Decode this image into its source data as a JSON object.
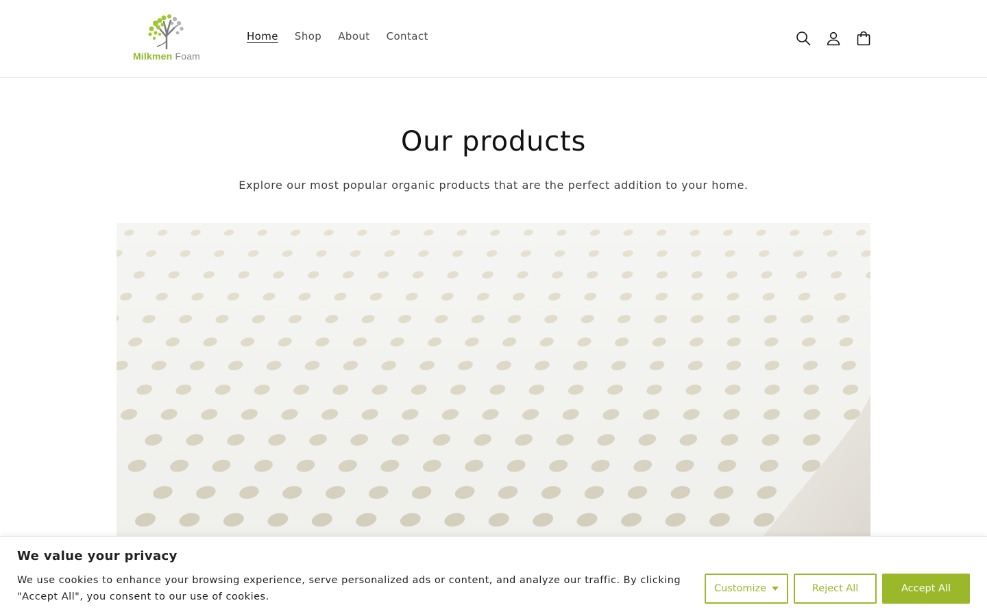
{
  "header": {
    "logo": {
      "word1": "Milkmen",
      "word2": "Foam",
      "brand_green": "#8dbb2b",
      "brand_gray": "#8a8a8a"
    },
    "nav": [
      {
        "label": "Home",
        "active": true
      },
      {
        "label": "Shop",
        "active": false
      },
      {
        "label": "About",
        "active": false
      },
      {
        "label": "Contact",
        "active": false
      }
    ],
    "icons": [
      "search-icon",
      "account-icon",
      "cart-icon"
    ]
  },
  "main": {
    "title": "Our products",
    "subtitle": "Explore our most popular organic products that are the perfect addition to your home.",
    "hero_image": "perforated-latex-foam"
  },
  "cookie": {
    "title": "We value your privacy",
    "text": "We use cookies to enhance your browsing experience, serve personalized ads or content, and analyze our traffic. By clicking \"Accept All\", you consent to our use of cookies.",
    "customize_label": "Customize",
    "reject_label": "Reject All",
    "accept_label": "Accept All",
    "accent_color": "#9ab82a"
  }
}
